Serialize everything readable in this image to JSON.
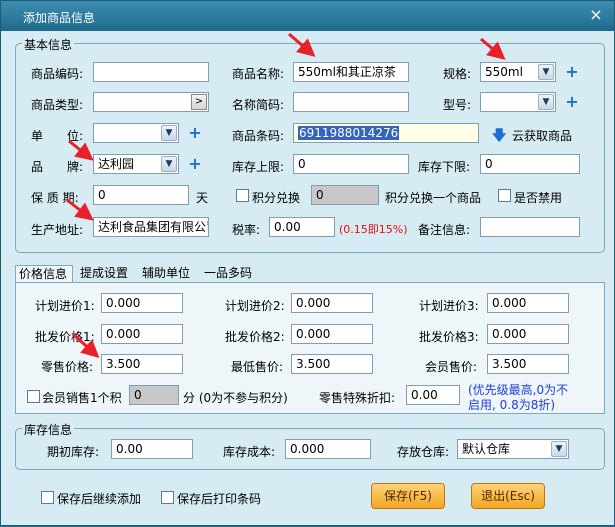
{
  "window": {
    "title": "添加商品信息",
    "close": "×"
  },
  "basic": {
    "group_title": "基本信息",
    "code_label": "商品编码:",
    "code_value": "",
    "name_label": "商品名称:",
    "name_value": "550ml和其正凉茶",
    "spec_label": "规格:",
    "spec_value": "550ml",
    "type_label": "商品类型:",
    "type_value": "",
    "type_btn": ">",
    "short_label": "名称简码:",
    "short_value": "",
    "model_label": "型号:",
    "model_value": "",
    "unit_label": "单　　位:",
    "unit_value": "",
    "barcode_label": "商品条码:",
    "barcode_value": "6911988014276",
    "cloud_label": "云获取商品",
    "cloud_icon": "down-arrow",
    "brand_label": "品　　牌:",
    "brand_value": "达利园",
    "stock_upper_label": "库存上限:",
    "stock_upper_value": "0",
    "stock_lower_label": "库存下限:",
    "stock_lower_value": "0",
    "shelf_label": "保 质 期:",
    "shelf_value": "0",
    "shelf_unit": "天",
    "points_label": "积分兑换",
    "points_value": "0",
    "points_suffix": "积分兑换一个商品",
    "disabled_label": "是否禁用",
    "addr_label": "生产地址:",
    "addr_value": "达利食品集团有限公司",
    "tax_label": "税率:",
    "tax_value": "0.00",
    "tax_note": "(0.15即15%)",
    "remark_label": "备注信息:",
    "remark_value": ""
  },
  "tabs": [
    "价格信息",
    "提成设置",
    "辅助单位",
    "一品多码"
  ],
  "price": {
    "plan1_label": "计划进价1:",
    "plan1_value": "0.000",
    "plan2_label": "计划进价2:",
    "plan2_value": "0.000",
    "plan3_label": "计划进价3:",
    "plan3_value": "0.000",
    "whole1_label": "批发价格1:",
    "whole1_value": "0.000",
    "whole2_label": "批发价格2:",
    "whole2_value": "0.000",
    "whole3_label": "批发价格3:",
    "whole3_value": "0.000",
    "retail_label": "零售价格:",
    "retail_value": "3.500",
    "min_label": "最低售价:",
    "min_value": "3.500",
    "member_label": "会员售价:",
    "member_value": "3.500",
    "member_points_label": "会员销售1个积",
    "member_points_value": "0",
    "member_points_suffix": "分 (0为不参与积分)",
    "discount_label": "零售特殊折扣:",
    "discount_value": "0.00",
    "discount_note_1": "(优先级最高,0为不",
    "discount_note_2": "启用, 0.8为8折)"
  },
  "stock": {
    "group_title": "库存信息",
    "init_label": "期初库存:",
    "init_value": "0.00",
    "cost_label": "库存成本:",
    "cost_value": "0.000",
    "warehouse_label": "存放仓库:",
    "warehouse_value": "默认仓库"
  },
  "footer": {
    "continue_label": "保存后继续添加",
    "print_label": "保存后打印条码",
    "save_btn": "保存(F5)",
    "exit_btn": "退出(Esc)"
  },
  "colors": {
    "accent": "#1d6fd1",
    "annotation": "#e8202a",
    "button": "#f3a623"
  }
}
